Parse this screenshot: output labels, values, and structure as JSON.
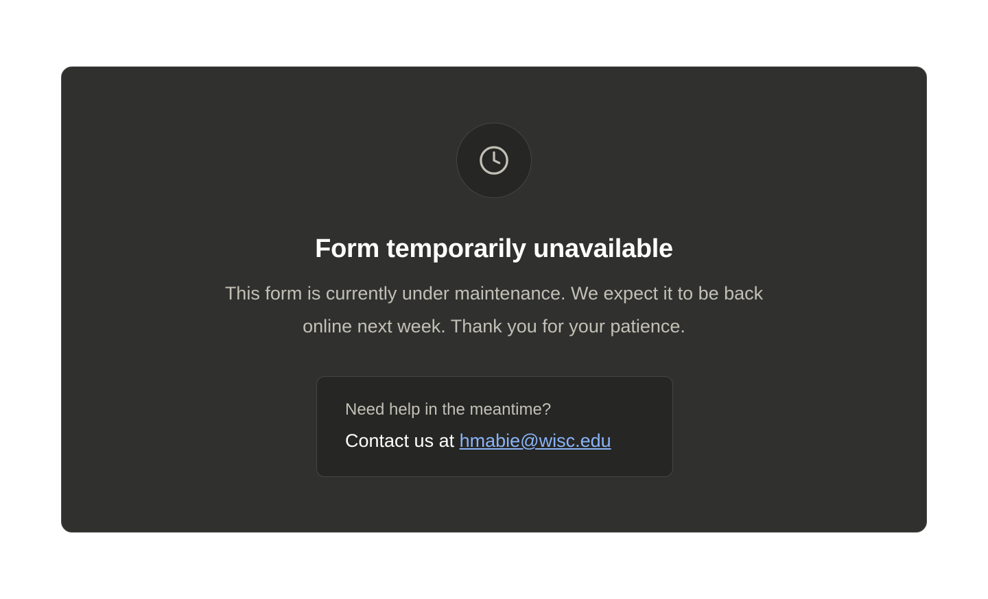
{
  "page": {
    "background_color": "#ffffff"
  },
  "card": {
    "background_color": "#30302e",
    "icon": "clock-icon",
    "title": "Form temporarily unavailable",
    "description": "This form is currently under maintenance. We expect it to be back online next week. Thank you for your patience."
  },
  "help": {
    "question": "Need help in the meantime?",
    "contact_prefix": "Contact us at",
    "email": "hmabie@wisc.edu",
    "link_color": "#8ab4f8"
  }
}
